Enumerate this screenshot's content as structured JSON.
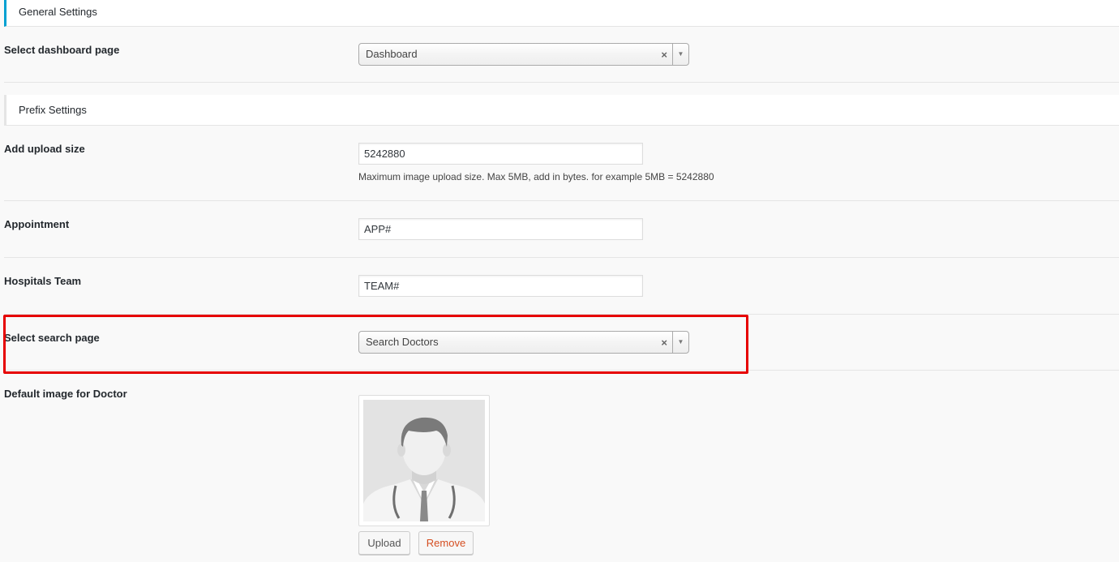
{
  "sections": {
    "general": "General Settings",
    "prefix": "Prefix Settings"
  },
  "general": {
    "dashboard_label": "Select dashboard page",
    "dashboard_value": "Dashboard",
    "clear_glyph": "×",
    "arrow_glyph": "▼"
  },
  "prefix": {
    "upload_label": "Add upload size",
    "upload_value": "5242880",
    "upload_hint": "Maximum image upload size. Max 5MB, add in bytes. for example 5MB = 5242880",
    "appointment_label": "Appointment",
    "appointment_value": "APP#",
    "team_label": "Hospitals Team",
    "team_value": "TEAM#",
    "search_label": "Select search page",
    "search_value": "Search Doctors",
    "image_label": "Default image for Doctor"
  },
  "buttons": {
    "upload": "Upload",
    "remove": "Remove"
  },
  "colors": {
    "accent": "#00a0d2",
    "highlight": "#e60000",
    "remove_text": "#d54e21"
  },
  "icons": {
    "doctor_avatar": "doctor-placeholder-icon",
    "clear": "clear-icon",
    "dropdown": "chevron-down-icon"
  }
}
